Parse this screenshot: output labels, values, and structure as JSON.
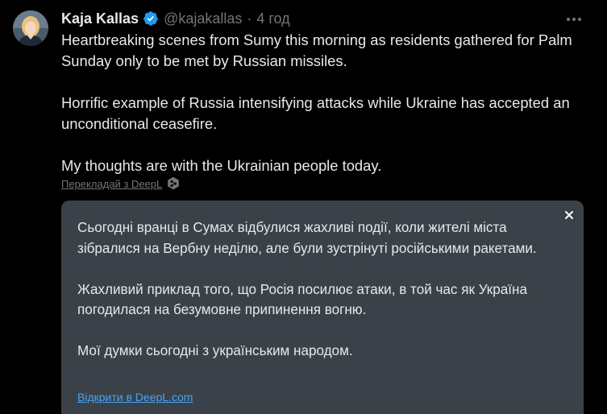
{
  "author": {
    "name": "Kaja Kallas",
    "handle": "@kajakallas",
    "separator": "·",
    "time": "4 год"
  },
  "icons": {
    "verified": "verified-badge-icon",
    "more": "more-options-icon",
    "deepl": "deepl-icon",
    "close": "close-icon"
  },
  "colors": {
    "background": "#000000",
    "text": "#e7e9ea",
    "muted": "#71767b",
    "verified": "#1d9bf0",
    "translation_bg": "#3b4148",
    "link": "#4aa3f0"
  },
  "tweet": {
    "paragraphs": [
      "Heartbreaking scenes from Sumy this morning as residents gathered for Palm Sunday only to be met by Russian missiles.",
      "Horrific example of Russia intensifying attacks while Ukraine has accepted an unconditional ceasefire.",
      "My thoughts are with the Ukrainian people today."
    ]
  },
  "translate": {
    "link_label": "Перекладай з DeepL"
  },
  "translation": {
    "paragraphs": [
      "Сьогодні вранці в Сумах відбулися жахливі події, коли жителі міста зібралися на Вербну неділю, але були зустрінуті російськими ракетами.",
      " Жахливий приклад того, що Росія посилює атаки, в той час як Україна погодилася на безумовне припинення вогню.",
      " Мої думки сьогодні з українським народом."
    ],
    "open_link": "Відкрити в DeepL.com"
  }
}
